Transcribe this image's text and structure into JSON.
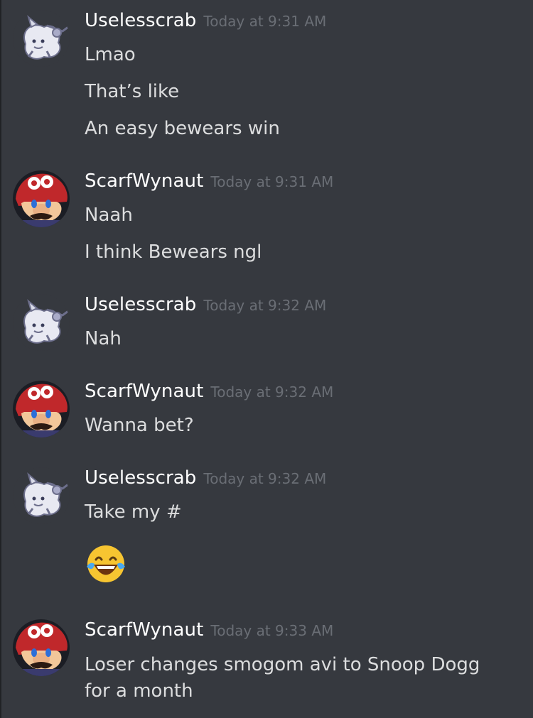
{
  "messages": [
    {
      "username": "Uselesscrab",
      "timestamp": "Today at 9:31 AM",
      "avatar": "creature-icon",
      "lines": [
        "Lmao",
        "That’s like",
        "An easy bewears win"
      ]
    },
    {
      "username": "ScarfWynaut",
      "timestamp": "Today at 9:31 AM",
      "avatar": "mario-icon",
      "lines": [
        "Naah",
        "I think Bewears ngl"
      ]
    },
    {
      "username": "Uselesscrab",
      "timestamp": "Today at 9:32 AM",
      "avatar": "creature-icon",
      "lines": [
        "Nah"
      ]
    },
    {
      "username": "ScarfWynaut",
      "timestamp": "Today at 9:32 AM",
      "avatar": "mario-icon",
      "lines": [
        "Wanna bet?"
      ]
    },
    {
      "username": "Uselesscrab",
      "timestamp": "Today at 9:32 AM",
      "avatar": "creature-icon",
      "lines": [
        "Take my #"
      ],
      "emoji": "laughing-tears-emoji"
    },
    {
      "username": "ScarfWynaut",
      "timestamp": "Today at 9:33 AM",
      "avatar": "mario-icon",
      "lines": [
        "Loser changes smogom avi to Snoop Dogg for a month"
      ]
    }
  ],
  "colors": {
    "background": "#36393f",
    "username": "#ffffff",
    "timestamp": "#6a6e75",
    "text": "#dcddde"
  }
}
